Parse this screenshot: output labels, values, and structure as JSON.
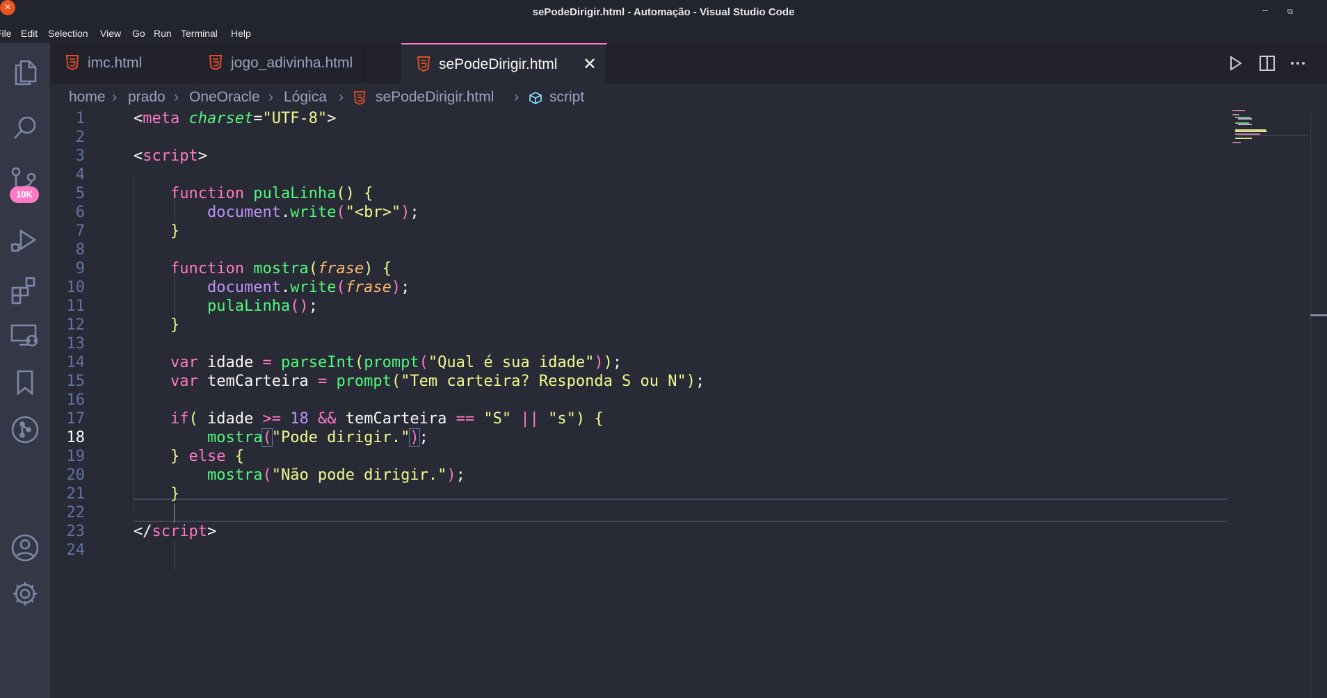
{
  "window": {
    "title": "sePodeDirigir.html - Automação - Visual Studio Code"
  },
  "menu": [
    "File",
    "Edit",
    "Selection",
    "View",
    "Go",
    "Run",
    "Terminal",
    "Help"
  ],
  "activity": {
    "scm_badge": "10K"
  },
  "tabs": [
    {
      "label": "imc.html",
      "active": false
    },
    {
      "label": "jogo_adivinha.html",
      "active": false
    },
    {
      "label": "sePodeDirigir.html",
      "active": true
    }
  ],
  "breadcrumbs": [
    "home",
    "prado",
    "OneOracle",
    "Lógica",
    "sePodeDirigir.html",
    "script"
  ],
  "editor": {
    "current_line": 18,
    "line_numbers": [
      "1",
      "2",
      "3",
      "4",
      "5",
      "6",
      "7",
      "8",
      "9",
      "10",
      "11",
      "12",
      "13",
      "14",
      "15",
      "16",
      "17",
      "18",
      "19",
      "20",
      "21",
      "22",
      "23",
      "24"
    ],
    "tokens": {
      "meta_tag": "meta",
      "meta_attr": "charset",
      "meta_value": "\"UTF-8\"",
      "script_tag": "script",
      "kw_function": "function",
      "fn_pulaLinha": "pulaLinha",
      "fn_mostra": "mostra",
      "obj_document": "document",
      "fn_write": "write",
      "str_br": "\"<br>\"",
      "param_frase": "frase",
      "kw_var": "var",
      "var_idade": "idade",
      "fn_parseInt": "parseInt",
      "fn_prompt": "prompt",
      "str_idade": "\"Qual é sua idade\"",
      "var_temCarteira": "temCarteira",
      "str_carteira": "\"Tem carteira? Responda S ou N\"",
      "kw_if": "if",
      "num_18": "18",
      "str_S": "\"S\"",
      "str_s": "\"s\"",
      "str_pode": "\"Pode dirigir.\"",
      "kw_else": "else",
      "str_nao_pode": "\"Não pode dirigir.\""
    }
  },
  "colors": {
    "accent": "#ff79c6",
    "background": "#282a36",
    "sidebar": "#343746",
    "close": "#e95420"
  }
}
